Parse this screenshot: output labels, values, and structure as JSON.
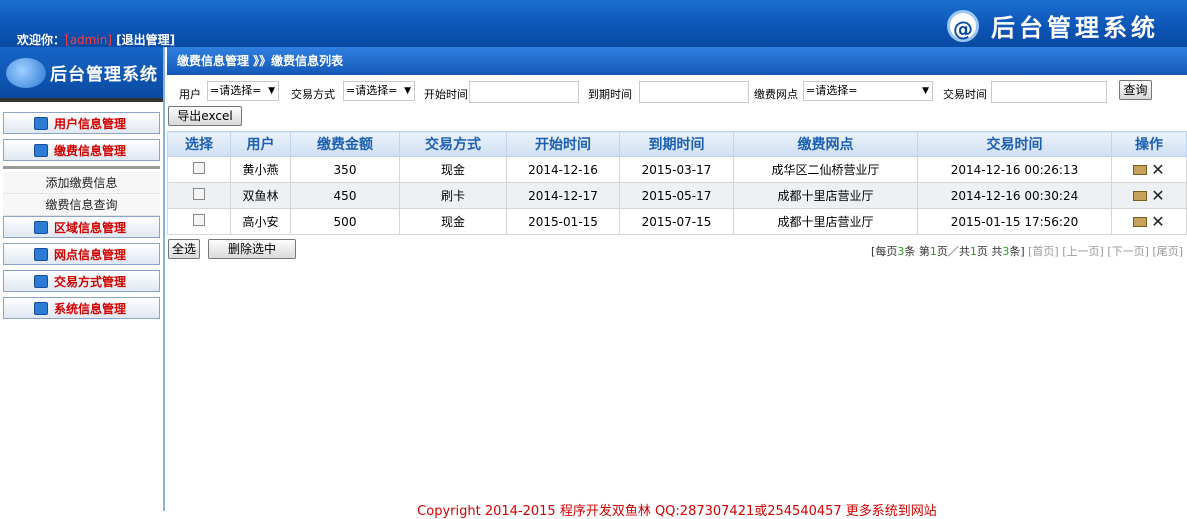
{
  "header": {
    "welcome_prefix": "欢迎你：",
    "admin": "[admin]",
    "logout": "[退出管理]",
    "at_logo": "@",
    "brand_title": "后台管理系统"
  },
  "sidebar": {
    "logo_text": "后台管理系统",
    "items": [
      {
        "label": "用户信息管理"
      },
      {
        "label": "缴费信息管理"
      },
      {
        "label": "区域信息管理"
      },
      {
        "label": "网点信息管理"
      },
      {
        "label": "交易方式管理"
      },
      {
        "label": "系统信息管理"
      }
    ],
    "subitems": [
      {
        "label": "添加缴费信息"
      },
      {
        "label": "缴费信息查询"
      }
    ]
  },
  "main": {
    "breadcrumb": "缴费信息管理 》》缴费信息列表",
    "filters": {
      "user_label": "用户",
      "user_select": "=请选择=",
      "trade_label": "交易方式",
      "trade_select": "=请选择=",
      "start_label": "开始时间",
      "end_label": "到期时间",
      "outlet_label": "缴费网点",
      "outlet_select": "=请选择=",
      "tradetime_label": "交易时间",
      "query_button": "查询",
      "export_button": "导出excel"
    },
    "table": {
      "headers": [
        "选择",
        "用户",
        "缴费金额",
        "交易方式",
        "开始时间",
        "到期时间",
        "缴费网点",
        "交易时间",
        "操作"
      ],
      "rows": [
        {
          "user": "黄小燕",
          "amount": "350",
          "method": "现金",
          "start": "2014-12-16",
          "end": "2015-03-17",
          "outlet": "成华区二仙桥营业厅",
          "time": "2014-12-16 00:26:13"
        },
        {
          "user": "双鱼林",
          "amount": "450",
          "method": "刷卡",
          "start": "2014-12-17",
          "end": "2015-05-17",
          "outlet": "成都十里店营业厅",
          "time": "2014-12-16 00:30:24"
        },
        {
          "user": "高小安",
          "amount": "500",
          "method": "现金",
          "start": "2015-01-15",
          "end": "2015-07-15",
          "outlet": "成都十里店营业厅",
          "time": "2015-01-15 17:56:20"
        }
      ]
    },
    "bottom": {
      "select_all": "全选",
      "delete_selected": "删除选中"
    },
    "pager": {
      "p1": "[每页",
      "per_page": "3",
      "p2": "条 第",
      "current": "1",
      "p3": "页／共",
      "total_pages": "1",
      "p4": "页 共",
      "total": "3",
      "p5": "条]",
      "first": "[首页]",
      "prev": "[上一页]",
      "next": "[下一页]",
      "last": "[尾页]"
    }
  },
  "footer": {
    "text": "Copyright 2014-2015 程序开发双鱼林 QQ:287307421或254540457 更多系统到网站"
  },
  "icons": {
    "edit": "edit-icon",
    "delete": "delete-icon",
    "menu": "menu-book-icon",
    "logo": "globe-logo-icon"
  }
}
